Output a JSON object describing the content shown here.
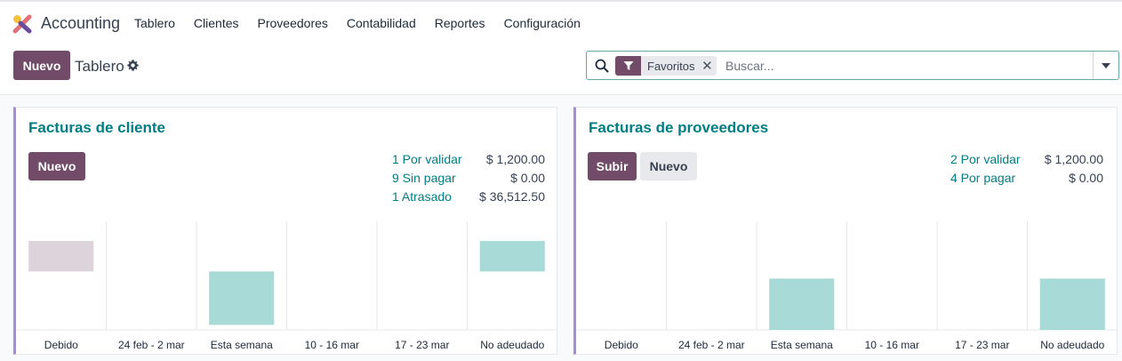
{
  "app": {
    "name": "Accounting"
  },
  "menu": [
    "Tablero",
    "Clientes",
    "Proveedores",
    "Contabilidad",
    "Reportes",
    "Configuración"
  ],
  "control": {
    "new_label": "Nuevo",
    "breadcrumb": "Tablero",
    "facet_label": "Favoritos",
    "search_placeholder": "Buscar..."
  },
  "colors": {
    "primary": "#714b67",
    "accent": "#017e84",
    "bar_teal": "#a8dad7",
    "bar_past": "#ddd3db",
    "card_border": "#a78bdb"
  },
  "cards": [
    {
      "title": "Facturas de cliente",
      "buttons": [
        "Nuevo"
      ],
      "stats": [
        {
          "label": "1 Por validar",
          "value": "$ 1,200.00"
        },
        {
          "label": "9 Sin pagar",
          "value": "$ 0.00"
        },
        {
          "label": "1 Atrasado",
          "value": "$ 36,512.50"
        }
      ],
      "chart_data": {
        "type": "bar",
        "categories": [
          "Debido",
          "24 feb - 2 mar",
          "Esta semana",
          "10 - 16 mar",
          "17 - 23 mar",
          "No adeudado"
        ],
        "values": [
          36512.5,
          0,
          -64000,
          0,
          0,
          36512.5
        ],
        "ylim": [
          -70000,
          60000
        ],
        "colors": [
          "#ddd3db",
          "#a8dad7",
          "#a8dad7",
          "#a8dad7",
          "#a8dad7",
          "#a8dad7"
        ]
      }
    },
    {
      "title": "Facturas de proveedores",
      "buttons": [
        "Subir",
        "Nuevo"
      ],
      "stats": [
        {
          "label": "2 Por validar",
          "value": "$ 1,200.00"
        },
        {
          "label": "4 Por pagar",
          "value": "$ 0.00"
        }
      ],
      "chart_data": {
        "type": "bar",
        "categories": [
          "Debido",
          "24 feb - 2 mar",
          "Esta semana",
          "10 - 16 mar",
          "17 - 23 mar",
          "No adeudado"
        ],
        "values": [
          0,
          0,
          52000,
          0,
          0,
          52000
        ],
        "ylim": [
          0,
          110000
        ],
        "colors": [
          "#a8dad7",
          "#a8dad7",
          "#a8dad7",
          "#a8dad7",
          "#a8dad7",
          "#a8dad7"
        ]
      }
    }
  ]
}
